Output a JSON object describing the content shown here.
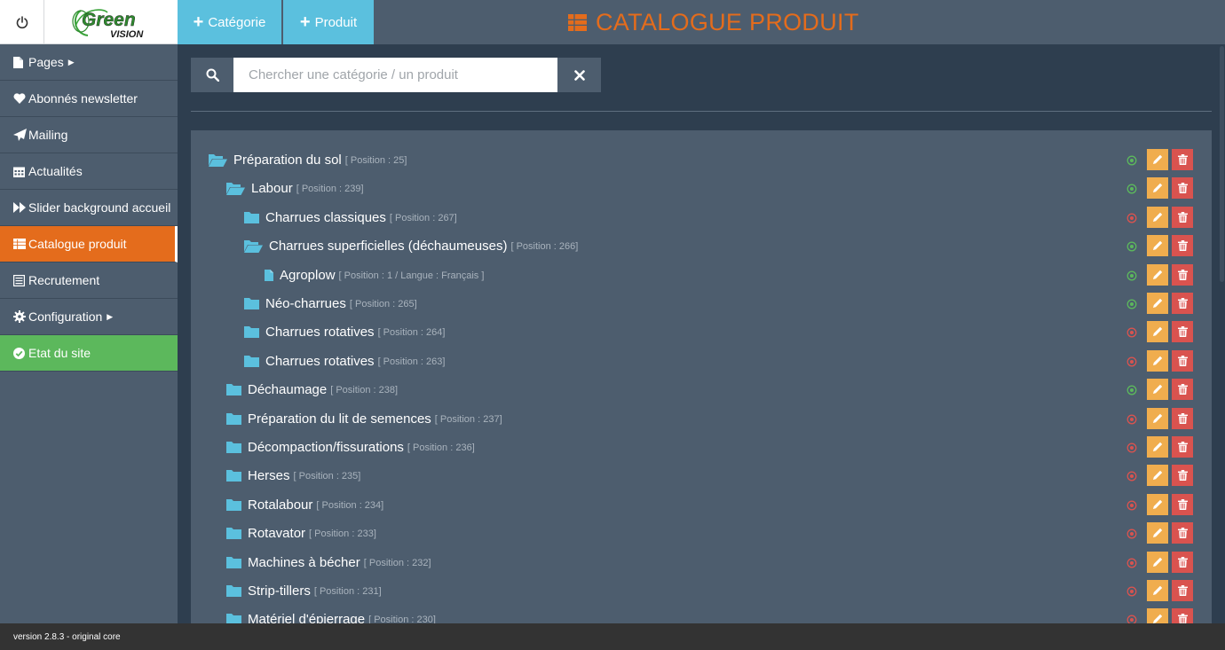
{
  "brand": {
    "logo_main": "Green",
    "logo_sub": "VISION"
  },
  "sidebar": {
    "items": [
      {
        "label": "Pages",
        "icon": "file-icon",
        "has_caret": true
      },
      {
        "label": "Abonnés newsletter",
        "icon": "heart-icon"
      },
      {
        "label": "Mailing",
        "icon": "paper-plane-icon"
      },
      {
        "label": "Actualités",
        "icon": "calendar-icon"
      },
      {
        "label": "Slider background accueil",
        "icon": "fast-forward-icon"
      },
      {
        "label": "Catalogue produit",
        "icon": "table-icon",
        "active": true
      },
      {
        "label": "Recrutement",
        "icon": "list-alt-icon"
      },
      {
        "label": "Configuration",
        "icon": "gear-icon",
        "has_caret": true
      },
      {
        "label": "Etat du site",
        "icon": "check-circle-icon"
      }
    ]
  },
  "topbar": {
    "add_category": "Catégorie",
    "add_product": "Produit",
    "title": "CATALOGUE PRODUIT"
  },
  "search": {
    "placeholder": "Chercher une catégorie / un produit",
    "value": ""
  },
  "tree": [
    {
      "label": "Préparation du sol",
      "pos": "[ Position : 25]",
      "level": 0,
      "type": "folder-open",
      "active": true
    },
    {
      "label": "Labour",
      "pos": "[ Position : 239]",
      "level": 1,
      "type": "folder-open",
      "active": true
    },
    {
      "label": "Charrues classiques",
      "pos": "[ Position : 267]",
      "level": 2,
      "type": "folder",
      "active": false
    },
    {
      "label": "Charrues superficielles (déchaumeuses)",
      "pos": "[ Position : 266]",
      "level": 2,
      "type": "folder-open",
      "active": true
    },
    {
      "label": "Agroplow",
      "pos": "[ Position : 1 / Langue : Français ]",
      "level": 3,
      "type": "file",
      "active": true
    },
    {
      "label": "Néo-charrues",
      "pos": "[ Position : 265]",
      "level": 2,
      "type": "folder",
      "active": true
    },
    {
      "label": "Charrues rotatives",
      "pos": "[ Position : 264]",
      "level": 2,
      "type": "folder",
      "active": false
    },
    {
      "label": "Charrues rotatives",
      "pos": "[ Position : 263]",
      "level": 2,
      "type": "folder",
      "active": false
    },
    {
      "label": "Déchaumage",
      "pos": "[ Position : 238]",
      "level": 1,
      "type": "folder",
      "active": true
    },
    {
      "label": "Préparation du lit de semences",
      "pos": "[ Position : 237]",
      "level": 1,
      "type": "folder",
      "active": false
    },
    {
      "label": "Décompaction/fissurations",
      "pos": "[ Position : 236]",
      "level": 1,
      "type": "folder",
      "active": false
    },
    {
      "label": "Herses",
      "pos": "[ Position : 235]",
      "level": 1,
      "type": "folder",
      "active": false
    },
    {
      "label": "Rotalabour",
      "pos": "[ Position : 234]",
      "level": 1,
      "type": "folder",
      "active": false
    },
    {
      "label": "Rotavator",
      "pos": "[ Position : 233]",
      "level": 1,
      "type": "folder",
      "active": false
    },
    {
      "label": "Machines à bécher",
      "pos": "[ Position : 232]",
      "level": 1,
      "type": "folder",
      "active": false
    },
    {
      "label": "Strip-tillers",
      "pos": "[ Position : 231]",
      "level": 1,
      "type": "folder",
      "active": false
    },
    {
      "label": "Matériel d'épierrage",
      "pos": "[ Position : 230]",
      "level": 1,
      "type": "folder",
      "active": false
    }
  ],
  "footer": {
    "version": "version 2.8.3 - original core"
  },
  "colors": {
    "accent": "#e46c1c",
    "info": "#5bc0de",
    "success": "#5cb85c",
    "warning": "#f0ad4e",
    "danger": "#d9534f",
    "status_on": "#5cb85c",
    "status_off": "#d9534f"
  }
}
